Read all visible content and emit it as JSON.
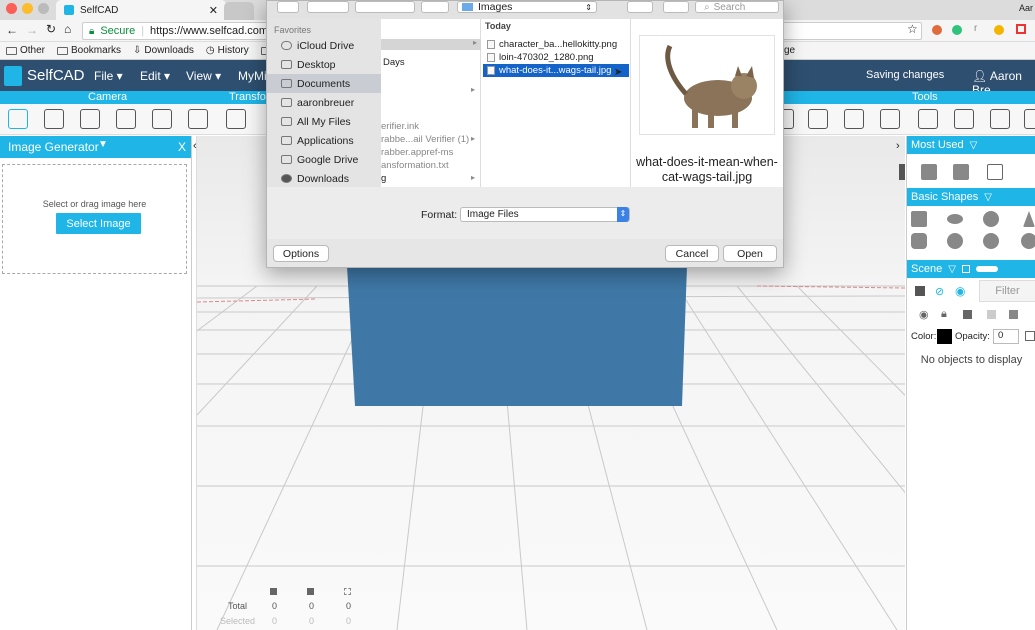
{
  "browser": {
    "tab_title": "SelfCAD",
    "url_secure": "Secure",
    "url": "https://www.selfcad.com/",
    "profile": "Aar",
    "bookmarks": [
      "Other",
      "Bookmarks",
      "Downloads",
      "History"
    ],
    "bookmark_right": "ge"
  },
  "app": {
    "logo": "SelfCAD",
    "menus": [
      "File",
      "Edit",
      "View",
      "MyMi"
    ],
    "saving": "Saving changes",
    "user": "Aaron Bre",
    "categories": {
      "camera": "Camera",
      "transform": "Transfo",
      "tools": "Tools"
    }
  },
  "left_panel": {
    "title": "Image Generator",
    "close": "X",
    "drop_text": "Select or drag image here",
    "button": "Select Image"
  },
  "right_panel": {
    "most_used": "Most Used",
    "basic_shapes": "Basic Shapes",
    "scene": "Scene",
    "filter": "Filter",
    "color_label": "Color:",
    "opacity_label": "Opacity:",
    "opacity_value": "0",
    "empty": "No objects to display"
  },
  "stats": {
    "total": "Total",
    "selected": "Selected",
    "total_vals": [
      "0",
      "0",
      "0"
    ],
    "selected_vals": [
      "0",
      "0",
      "0"
    ]
  },
  "dialog": {
    "location": "Images",
    "search_placeholder": "Search",
    "favorites_label": "Favorites",
    "favorites": [
      "iCloud Drive",
      "Desktop",
      "Documents",
      "aaronbreuer",
      "All My Files",
      "Applications",
      "Google Drive",
      "Downloads"
    ],
    "col1_items": [
      "Days",
      "erifier.ink",
      "rabbe...ail Verifier (1)",
      "rabber.appref-ms",
      "ansformation.txt",
      "g"
    ],
    "col2_header": "Today",
    "files": [
      "character_ba...hellokitty.png",
      "loin-470302_1280.png",
      "what-does-it...wags-tail.jpg"
    ],
    "preview_name": "what-does-it-mean-when-cat-wags-tail.jpg",
    "format_label": "Format:",
    "format_value": "Image Files",
    "options": "Options",
    "cancel": "Cancel",
    "open": "Open"
  }
}
